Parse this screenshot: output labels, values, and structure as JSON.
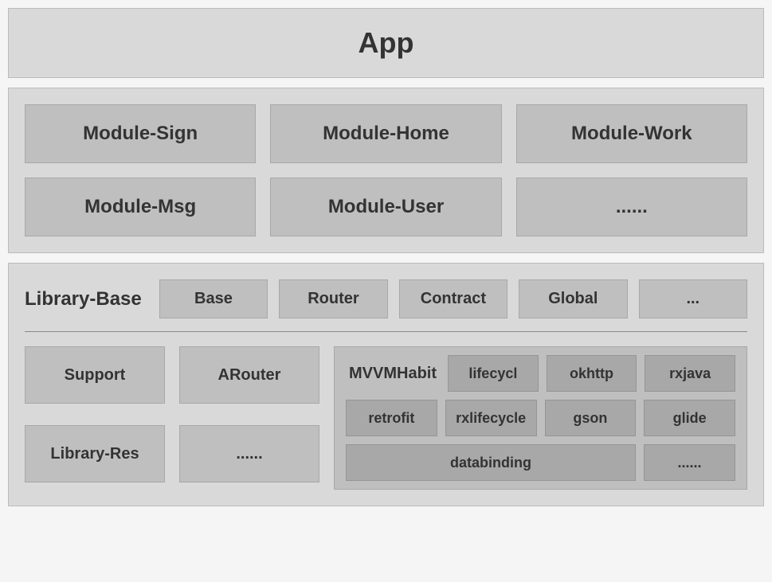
{
  "app": {
    "title": "App"
  },
  "modules": {
    "items": [
      "Module-Sign",
      "Module-Home",
      "Module-Work",
      "Module-Msg",
      "Module-User",
      "......"
    ]
  },
  "library": {
    "baseLabel": "Library-Base",
    "baseItems": [
      "Base",
      "Router",
      "Contract",
      "Global",
      "..."
    ],
    "leftItems": [
      "Support",
      "ARouter",
      "Library-Res",
      "......"
    ],
    "mvvm": {
      "label": "MVVMHabit",
      "row1": [
        "lifecycl",
        "okhttp",
        "rxjava"
      ],
      "row2": [
        "retrofit",
        "rxlifecycle",
        "gson",
        "glide"
      ],
      "row3": [
        "databinding",
        "......"
      ]
    }
  }
}
